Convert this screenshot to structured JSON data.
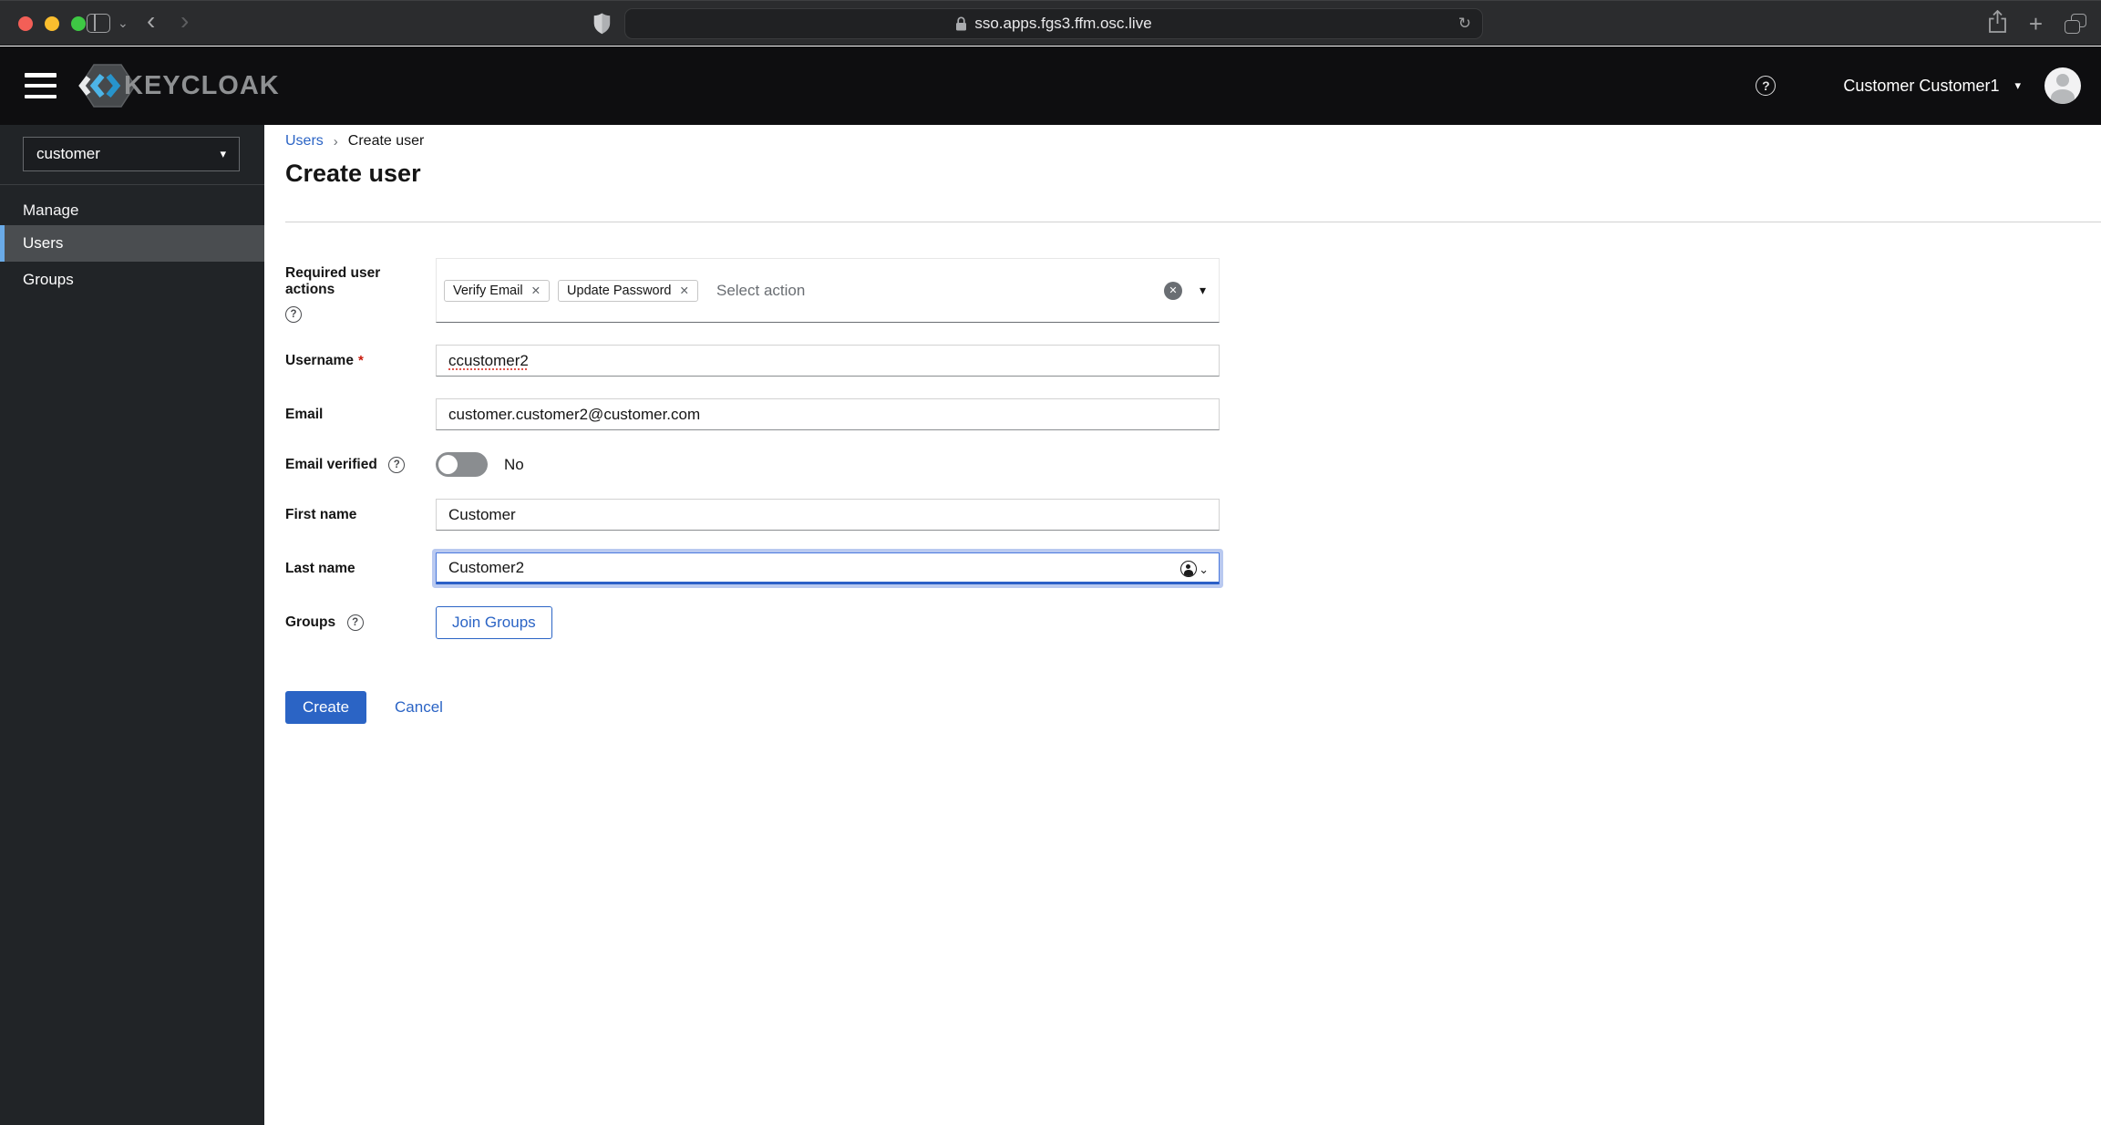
{
  "browser": {
    "address": "sso.apps.fgs3.ffm.osc.live"
  },
  "header": {
    "brand": "KEYCLOAK",
    "user": "Customer Customer1"
  },
  "sidebar": {
    "realm": "customer",
    "section_label": "Manage",
    "items": [
      {
        "label": "Users",
        "active": true
      },
      {
        "label": "Groups",
        "active": false
      }
    ]
  },
  "breadcrumb": {
    "root": "Users",
    "current": "Create user"
  },
  "page": {
    "title": "Create user"
  },
  "form": {
    "required_actions": {
      "label": "Required user actions",
      "chips": [
        "Verify Email",
        "Update Password"
      ],
      "placeholder": "Select action"
    },
    "username": {
      "label": "Username",
      "value": "ccustomer2",
      "required": true
    },
    "email": {
      "label": "Email",
      "value": "customer.customer2@customer.com"
    },
    "email_verified": {
      "label": "Email verified",
      "value": "No"
    },
    "first_name": {
      "label": "First name",
      "value": "Customer"
    },
    "last_name": {
      "label": "Last name",
      "value": "Customer2"
    },
    "groups": {
      "label": "Groups",
      "join_button": "Join Groups"
    },
    "actions": {
      "create": "Create",
      "cancel": "Cancel"
    }
  },
  "icons": {
    "caret_down": "▾",
    "chevron_down": "⌄",
    "close": "✕",
    "help": "?",
    "plus": "+",
    "back": "‹",
    "forward": "›",
    "reload": "↻",
    "asterisk": "*"
  },
  "colors": {
    "accent": "#2b64c5",
    "danger": "#c9190b",
    "masthead_bg": "#0e0e10",
    "sidebar_bg": "#212427",
    "nav_selected_bg": "#4a4d50",
    "nav_accent": "#6aabe8",
    "brand_blue": "#3eb1e6"
  }
}
